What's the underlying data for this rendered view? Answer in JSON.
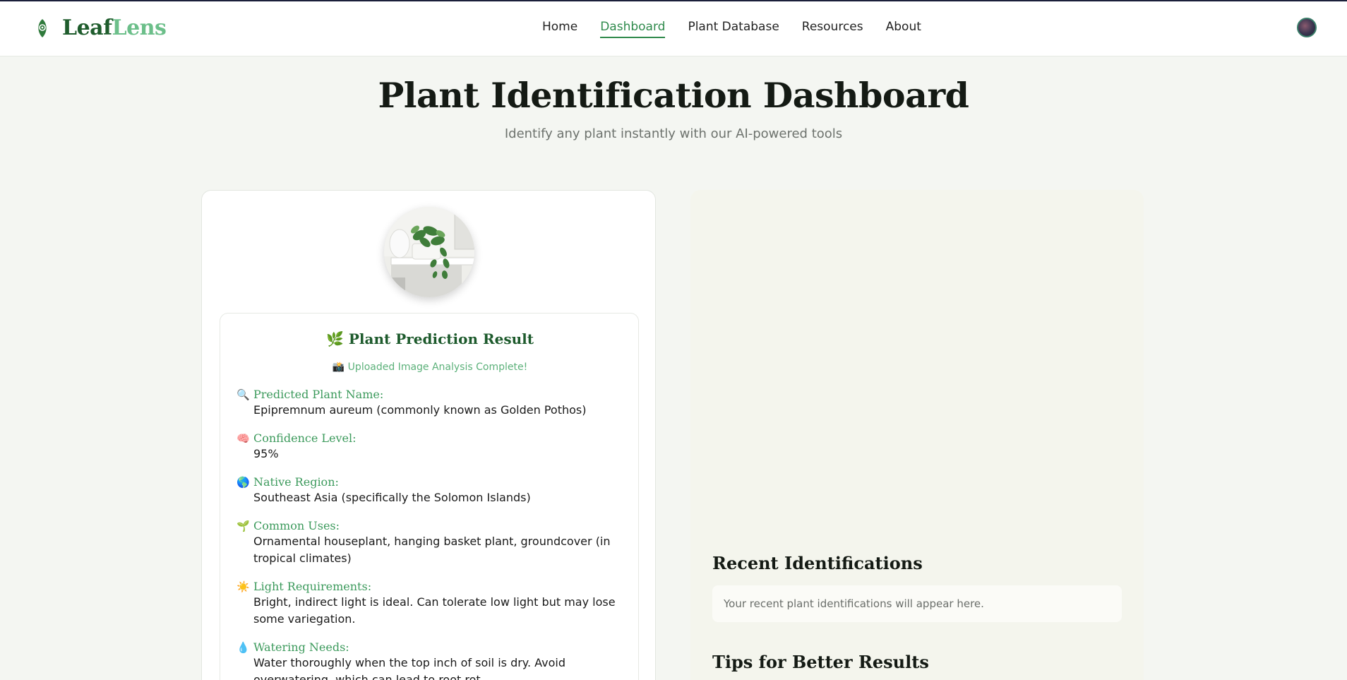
{
  "brand": {
    "name_part1": "Leaf",
    "name_part2": "Lens"
  },
  "nav": {
    "items": [
      {
        "label": "Home",
        "active": false
      },
      {
        "label": "Dashboard",
        "active": true
      },
      {
        "label": "Plant Database",
        "active": false
      },
      {
        "label": "Resources",
        "active": false
      },
      {
        "label": "About",
        "active": false
      }
    ]
  },
  "header": {
    "title": "Plant Identification Dashboard",
    "subtitle": "Identify any plant instantly with our AI-powered tools"
  },
  "result": {
    "title": "🌿 Plant Prediction Result",
    "status": "📸 Uploaded Image Analysis Complete!",
    "fields": [
      {
        "icon": "🔍",
        "label": "Predicted Plant Name:",
        "value": "Epipremnum aureum (commonly known as Golden Pothos)"
      },
      {
        "icon": "🧠",
        "label": "Confidence Level:",
        "value": "95%"
      },
      {
        "icon": "🌎",
        "label": "Native Region:",
        "value": "Southeast Asia (specifically the Solomon Islands)"
      },
      {
        "icon": "🌱",
        "label": "Common Uses:",
        "value": "Ornamental houseplant, hanging basket plant, groundcover (in tropical climates)"
      },
      {
        "icon": "☀️",
        "label": "Light Requirements:",
        "value": "Bright, indirect light is ideal. Can tolerate low light but may lose some variegation."
      },
      {
        "icon": "💧",
        "label": "Watering Needs:",
        "value": "Water thoroughly when the top inch of soil is dry. Avoid overwatering, which can lead to root rot."
      }
    ]
  },
  "sidebar": {
    "recent_title": "Recent Identifications",
    "recent_empty": "Your recent plant identifications will appear here.",
    "tips_title": "Tips for Better Results"
  },
  "colors": {
    "brand_dark": "#1e5c2c",
    "brand_light": "#6cbf8a",
    "accent": "#2f8a4c",
    "label": "#3c9a5c",
    "page_bg": "#f4f6f2",
    "panel_bg": "#f4f5ed"
  }
}
